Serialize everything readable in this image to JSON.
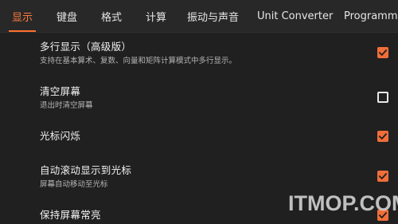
{
  "tabs": [
    {
      "label": "显示",
      "active": true
    },
    {
      "label": "键盘",
      "active": false
    },
    {
      "label": "格式",
      "active": false
    },
    {
      "label": "计算",
      "active": false
    },
    {
      "label": "振动与声音",
      "active": false
    },
    {
      "label": "Unit Converter",
      "active": false
    },
    {
      "label": "Programm",
      "active": false
    }
  ],
  "settings": [
    {
      "title": "多行显示（高级版）",
      "subtitle": "支持在基本算术、复数、向量和矩阵计算模式中多行显示。",
      "checked": true
    },
    {
      "title": "清空屏幕",
      "subtitle": "退出时清空屏幕",
      "checked": false
    },
    {
      "title": "光标闪烁",
      "subtitle": "",
      "checked": true
    },
    {
      "title": "自动滚动显示到光标",
      "subtitle": "屏幕自动移动至光标",
      "checked": true
    },
    {
      "title": "保持屏幕常亮",
      "subtitle": "",
      "checked": true
    }
  ],
  "watermark": "ITMOP.COM",
  "colors": {
    "accent": "#f06e3a",
    "background": "#202020",
    "tabbar": "#282828"
  }
}
